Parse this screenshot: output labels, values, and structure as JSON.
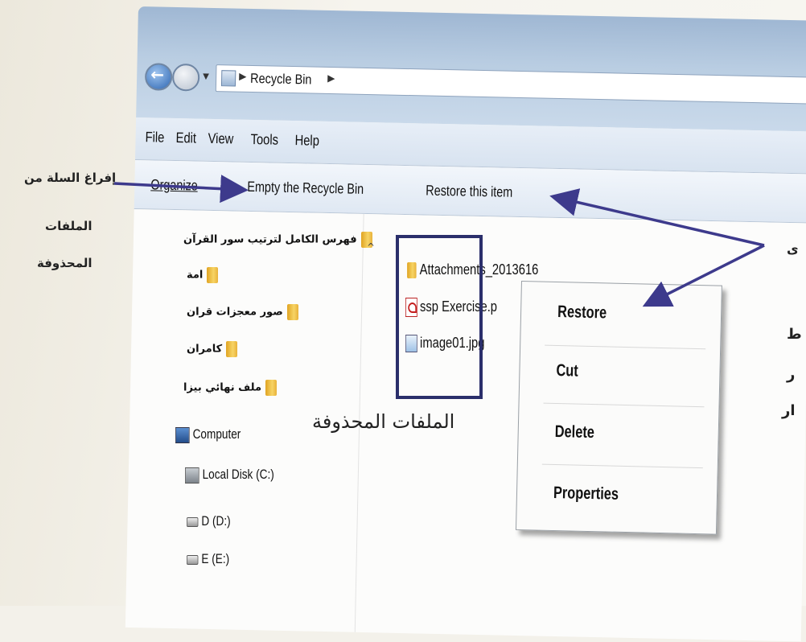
{
  "explorer": {
    "breadcrumb": [
      "Recycle Bin"
    ],
    "menu": [
      "File",
      "Edit",
      "View",
      "Tools",
      "Help"
    ],
    "toolbar": {
      "organize": "Organize",
      "empty": "Empty the Recycle Bin",
      "restore": "Restore this item"
    },
    "tree": [
      {
        "label": "فهرس الكامل لترتيب سور القرآن",
        "icon": "folder-icon"
      },
      {
        "label": "امة",
        "icon": "folder-icon"
      },
      {
        "label": "صور معجزات قران",
        "icon": "folder-icon"
      },
      {
        "label": "كامران",
        "icon": "folder-icon"
      },
      {
        "label": "ملف نهائي بيزا",
        "icon": "folder-icon"
      },
      {
        "label": "Computer",
        "icon": "computer-icon"
      },
      {
        "label": "Local Disk (C:)",
        "icon": "local-disk-icon"
      },
      {
        "label": "D (D:)",
        "icon": "drive-icon"
      },
      {
        "label": "E (E:)",
        "icon": "drive-icon"
      }
    ],
    "files": [
      {
        "name": "Attachments_2013616",
        "icon": "folder-icon"
      },
      {
        "name": "ssp Exercise.p",
        "icon": "pdf-icon"
      },
      {
        "name": "image01.jpg",
        "icon": "image-icon"
      }
    ],
    "context_menu": [
      "Restore",
      "Cut",
      "Delete",
      "Properties"
    ]
  },
  "annotations": {
    "empty_bin_note": [
      "إفراغ السلة من",
      "الملفات",
      "المحذوفة"
    ],
    "deleted_files_label": "الملفات المحذوفة",
    "right_fragments": [
      "ى",
      "ط",
      "ر",
      "ار"
    ]
  },
  "colors": {
    "arrow": "#3d3a8c",
    "selection_box": "#2b2f6b"
  }
}
